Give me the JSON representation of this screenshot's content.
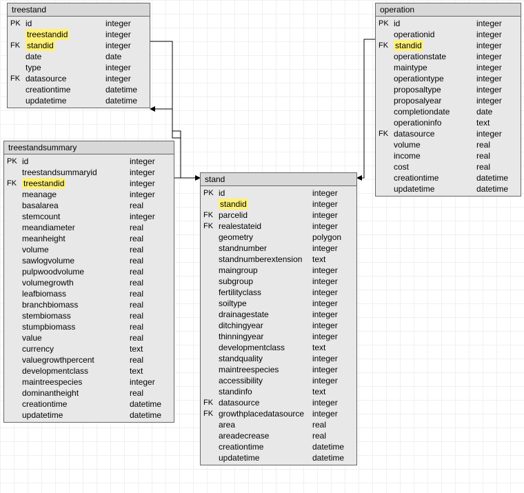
{
  "tables": {
    "treestand": {
      "name": "treestand",
      "columns": [
        {
          "key": "PK",
          "name": "id",
          "type": "integer",
          "hl": false
        },
        {
          "key": "",
          "name": "treestandid",
          "type": "integer",
          "hl": true
        },
        {
          "key": "FK",
          "name": "standid",
          "type": "integer",
          "hl": true
        },
        {
          "key": "",
          "name": "date",
          "type": "date",
          "hl": false
        },
        {
          "key": "",
          "name": "type",
          "type": "integer",
          "hl": false
        },
        {
          "key": "FK",
          "name": "datasource",
          "type": "integer",
          "hl": false
        },
        {
          "key": "",
          "name": "creationtime",
          "type": "datetime",
          "hl": false
        },
        {
          "key": "",
          "name": "updatetime",
          "type": "datetime",
          "hl": false
        }
      ]
    },
    "treestandsummary": {
      "name": "treestandsummary",
      "columns": [
        {
          "key": "PK",
          "name": "id",
          "type": "integer",
          "hl": false
        },
        {
          "key": "",
          "name": "treestandsummaryid",
          "type": "integer",
          "hl": false
        },
        {
          "key": "FK",
          "name": "treestandid",
          "type": "integer",
          "hl": true
        },
        {
          "key": "",
          "name": "meanage",
          "type": "integer",
          "hl": false
        },
        {
          "key": "",
          "name": "basalarea",
          "type": "real",
          "hl": false
        },
        {
          "key": "",
          "name": "stemcount",
          "type": "integer",
          "hl": false
        },
        {
          "key": "",
          "name": "meandiameter",
          "type": "real",
          "hl": false
        },
        {
          "key": "",
          "name": "meanheight",
          "type": "real",
          "hl": false
        },
        {
          "key": "",
          "name": "volume",
          "type": "real",
          "hl": false
        },
        {
          "key": "",
          "name": "sawlogvolume",
          "type": "real",
          "hl": false
        },
        {
          "key": "",
          "name": "pulpwoodvolume",
          "type": "real",
          "hl": false
        },
        {
          "key": "",
          "name": "volumegrowth",
          "type": "real",
          "hl": false
        },
        {
          "key": "",
          "name": "leafbiomass",
          "type": "real",
          "hl": false
        },
        {
          "key": "",
          "name": "branchbiomass",
          "type": "real",
          "hl": false
        },
        {
          "key": "",
          "name": "stembiomass",
          "type": "real",
          "hl": false
        },
        {
          "key": "",
          "name": "stumpbiomass",
          "type": "real",
          "hl": false
        },
        {
          "key": "",
          "name": "value",
          "type": "real",
          "hl": false
        },
        {
          "key": "",
          "name": "currency",
          "type": "text",
          "hl": false
        },
        {
          "key": "",
          "name": "valuegrowthpercent",
          "type": "real",
          "hl": false
        },
        {
          "key": "",
          "name": "developmentclass",
          "type": "text",
          "hl": false
        },
        {
          "key": "",
          "name": "maintreespecies",
          "type": "integer",
          "hl": false
        },
        {
          "key": "",
          "name": "dominantheight",
          "type": "real",
          "hl": false
        },
        {
          "key": "",
          "name": "creationtime",
          "type": "datetime",
          "hl": false
        },
        {
          "key": "",
          "name": "updatetime",
          "type": "datetime",
          "hl": false
        }
      ]
    },
    "stand": {
      "name": "stand",
      "columns": [
        {
          "key": "PK",
          "name": "id",
          "type": "integer",
          "hl": false
        },
        {
          "key": "",
          "name": "standid",
          "type": "integer",
          "hl": true
        },
        {
          "key": "FK",
          "name": "parcelid",
          "type": "integer",
          "hl": false
        },
        {
          "key": "FK",
          "name": "realestateid",
          "type": "integer",
          "hl": false
        },
        {
          "key": "",
          "name": "geometry",
          "type": "polygon",
          "hl": false
        },
        {
          "key": "",
          "name": "standnumber",
          "type": "integer",
          "hl": false
        },
        {
          "key": "",
          "name": "standnumberextension",
          "type": "text",
          "hl": false
        },
        {
          "key": "",
          "name": "maingroup",
          "type": "integer",
          "hl": false
        },
        {
          "key": "",
          "name": "subgroup",
          "type": "integer",
          "hl": false
        },
        {
          "key": "",
          "name": "fertilityclass",
          "type": "integer",
          "hl": false
        },
        {
          "key": "",
          "name": "soiltype",
          "type": "integer",
          "hl": false
        },
        {
          "key": "",
          "name": "drainagestate",
          "type": "integer",
          "hl": false
        },
        {
          "key": "",
          "name": "ditchingyear",
          "type": "integer",
          "hl": false
        },
        {
          "key": "",
          "name": "thinningyear",
          "type": "integer",
          "hl": false
        },
        {
          "key": "",
          "name": "developmentclass",
          "type": "text",
          "hl": false
        },
        {
          "key": "",
          "name": "standquality",
          "type": "integer",
          "hl": false
        },
        {
          "key": "",
          "name": "maintreespecies",
          "type": "integer",
          "hl": false
        },
        {
          "key": "",
          "name": "accessibility",
          "type": "integer",
          "hl": false
        },
        {
          "key": "",
          "name": "standinfo",
          "type": "text",
          "hl": false
        },
        {
          "key": "FK",
          "name": "datasource",
          "type": "integer",
          "hl": false
        },
        {
          "key": "FK",
          "name": "growthplacedatasource",
          "type": "integer",
          "hl": false
        },
        {
          "key": "",
          "name": "area",
          "type": "real",
          "hl": false
        },
        {
          "key": "",
          "name": "areadecrease",
          "type": "real",
          "hl": false
        },
        {
          "key": "",
          "name": "creationtime",
          "type": "datetime",
          "hl": false
        },
        {
          "key": "",
          "name": "updatetime",
          "type": "datetime",
          "hl": false
        }
      ]
    },
    "operation": {
      "name": "operation",
      "columns": [
        {
          "key": "PK",
          "name": "id",
          "type": "integer",
          "hl": false
        },
        {
          "key": "",
          "name": "operationid",
          "type": "integer",
          "hl": false
        },
        {
          "key": "FK",
          "name": "standid",
          "type": "integer",
          "hl": true
        },
        {
          "key": "",
          "name": "operationstate",
          "type": "integer",
          "hl": false
        },
        {
          "key": "",
          "name": "maintype",
          "type": "integer",
          "hl": false
        },
        {
          "key": "",
          "name": "operationtype",
          "type": "integer",
          "hl": false
        },
        {
          "key": "",
          "name": "proposaltype",
          "type": "integer",
          "hl": false
        },
        {
          "key": "",
          "name": "proposalyear",
          "type": "integer",
          "hl": false
        },
        {
          "key": "",
          "name": "completiondate",
          "type": "date",
          "hl": false
        },
        {
          "key": "",
          "name": "operationinfo",
          "type": "text",
          "hl": false
        },
        {
          "key": "FK",
          "name": "datasource",
          "type": "integer",
          "hl": false
        },
        {
          "key": "",
          "name": "volume",
          "type": "real",
          "hl": false
        },
        {
          "key": "",
          "name": "income",
          "type": "real",
          "hl": false
        },
        {
          "key": "",
          "name": "cost",
          "type": "real",
          "hl": false
        },
        {
          "key": "",
          "name": "creationtime",
          "type": "datetime",
          "hl": false
        },
        {
          "key": "",
          "name": "updatetime",
          "type": "datetime",
          "hl": false
        }
      ]
    }
  }
}
